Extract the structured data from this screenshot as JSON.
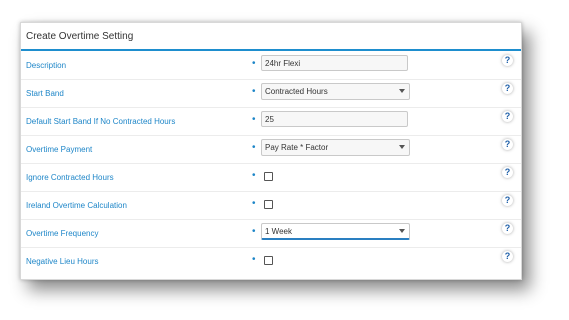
{
  "card": {
    "title": "Create Overtime Setting"
  },
  "required_marker": "•",
  "help_marker": "?",
  "rows": [
    {
      "label": "Description",
      "control": "text",
      "value": "24hr Flexi"
    },
    {
      "label": "Start Band",
      "control": "select",
      "value": "Contracted Hours"
    },
    {
      "label": "Default Start Band If No Contracted Hours",
      "control": "text",
      "value": "25"
    },
    {
      "label": "Overtime Payment",
      "control": "select",
      "value": "Pay Rate * Factor"
    },
    {
      "label": "Ignore Contracted Hours",
      "control": "checkbox",
      "checked": false
    },
    {
      "label": "Ireland Overtime Calculation",
      "control": "checkbox",
      "checked": false
    },
    {
      "label": "Overtime Frequency",
      "control": "select",
      "value": "1 Week",
      "focused": true
    },
    {
      "label": "Negative Lieu Hours",
      "control": "checkbox",
      "checked": false
    }
  ],
  "colors": {
    "accent": "#1e8ece",
    "label": "#1e86c8",
    "help": "#1e5fa8"
  }
}
